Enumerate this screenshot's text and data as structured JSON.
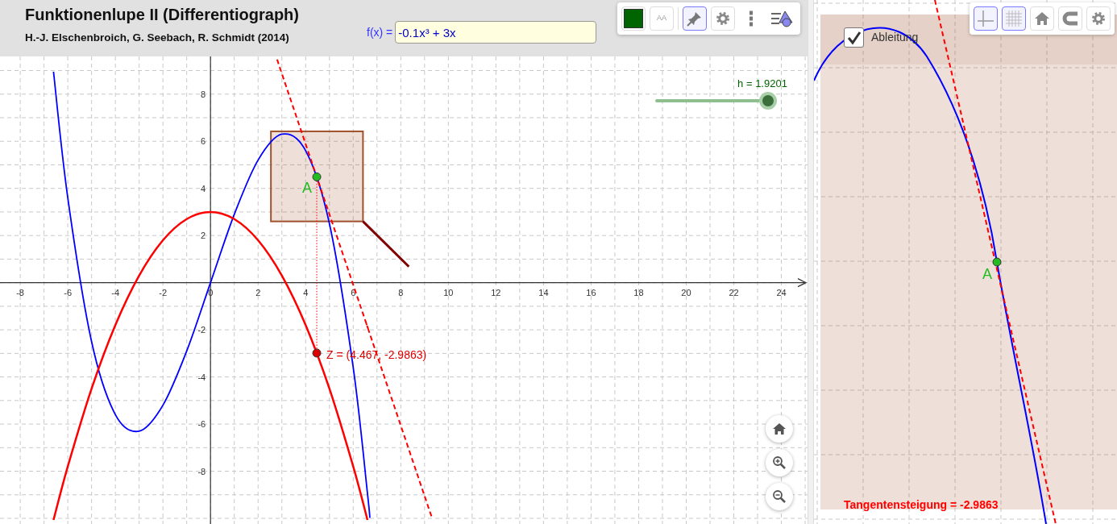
{
  "header": {
    "title": "Funktionenlupe II  (Differentiograph)",
    "authors": "H.-J. Elschenbroich, G. Seebach, R. Schmidt (2014)"
  },
  "function_input": {
    "label": "f(x) =",
    "value": "-0.1x³ + 3x"
  },
  "graphics_toolbar": [
    {
      "kind": "color",
      "color": "#006400",
      "selected": false
    },
    {
      "kind": "text-size",
      "label": "AA",
      "selected": false
    },
    {
      "kind": "pin",
      "selected": true
    },
    {
      "kind": "settings",
      "selected": false
    },
    {
      "kind": "more",
      "selected": false
    },
    {
      "kind": "view-menu",
      "selected": false
    }
  ],
  "slider": {
    "label": "h = 1.9201",
    "level": 1
  },
  "graphics": {
    "chart_data": {
      "type": "line",
      "x": [
        -6.6,
        -6,
        -5,
        -4,
        -3,
        -2,
        -1,
        0,
        1,
        2,
        2.8,
        3,
        4,
        5,
        6,
        6.6,
        6.7,
        9,
        9.3
      ],
      "series": [
        {
          "color": "#0000ff",
          "line_style": "solid",
          "values": [
            8.95,
            3.6,
            -2.5,
            -5.6,
            -6.3,
            -5.2,
            -2.9,
            0,
            2.9,
            5.2,
            null,
            6.3,
            5.6,
            2.5,
            -3.6,
            -8.95,
            -9.98,
            null,
            null
          ]
        },
        {
          "color": "#ff0000",
          "line_style": "solid",
          "values": [
            -10.07,
            -7.8,
            -4.5,
            -1.8,
            0.3,
            1.8,
            2.7,
            3,
            2.7,
            1.8,
            null,
            0.3,
            -1.8,
            -4.5,
            -7.8,
            -10.07,
            null,
            null,
            null
          ]
        },
        {
          "color": "#ff0000",
          "line_style": "dashed",
          "values": [
            null,
            null,
            null,
            null,
            null,
            null,
            null,
            null,
            null,
            null,
            9.47,
            8.87,
            5.88,
            2.9,
            -0.09,
            -1.88,
            -2.18,
            -9.05,
            -9.94
          ]
        }
      ],
      "grid": true,
      "xlim": [
        -8.85,
        25.1
      ],
      "ylim": [
        -10.24,
        9.6
      ],
      "xticks": [
        -8,
        -6,
        -4,
        -2,
        0,
        2,
        4,
        6,
        8,
        10,
        12,
        14,
        16,
        18,
        20,
        22,
        24
      ],
      "yticks": [
        -8,
        -6,
        -4,
        -2,
        2,
        4,
        6,
        8
      ],
      "annotations": [
        {
          "x": 4.467,
          "y": 4.488,
          "text": "A"
        },
        {
          "x": 4.467,
          "y": -2.9863,
          "text": "Z = (4.467, -2.9863)"
        }
      ]
    }
  },
  "zoom_view": {
    "checkbox": {
      "label": "Ableitung",
      "checked": true
    },
    "point_label": "A",
    "slope_text": "Tangentensteigung = -2.9863",
    "toolbar": [
      {
        "kind": "axes",
        "selected": true
      },
      {
        "kind": "grid",
        "selected": true
      },
      {
        "kind": "home",
        "selected": false
      },
      {
        "kind": "magnet",
        "selected": false
      },
      {
        "kind": "settings",
        "selected": false
      }
    ]
  }
}
